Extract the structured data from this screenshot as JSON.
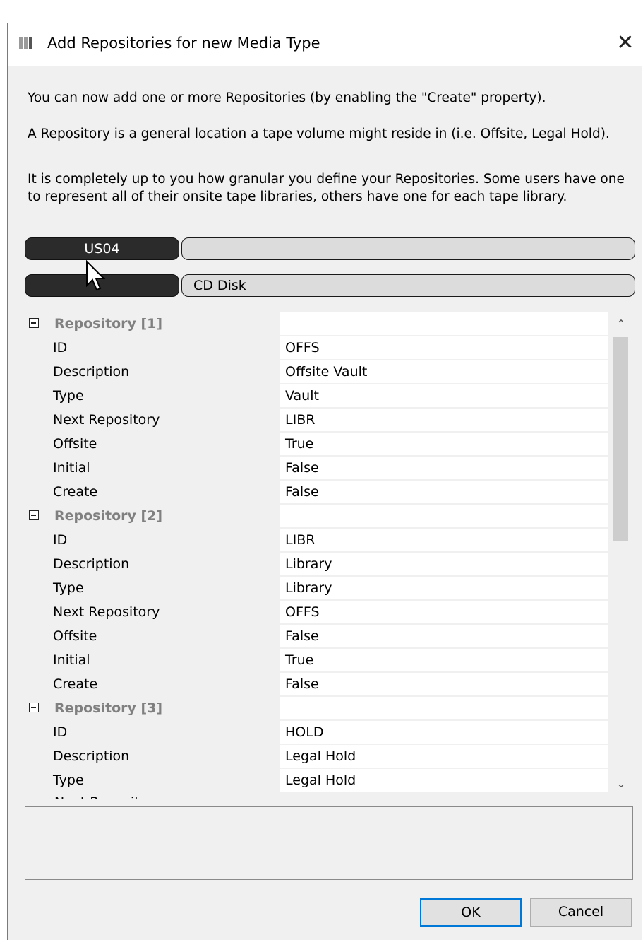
{
  "dialog": {
    "title": "Add Repositories for new Media Type",
    "close_glyph": "✕",
    "app_icon": "app-window-icon"
  },
  "intro": {
    "line1": "You can now add one or more Repositories (by enabling the \"Create\" property).",
    "line2": "A Repository is a general location a tape volume might reside in (i.e. Offsite, Legal Hold).",
    "line3": "It is completely up to you how granular you define your Repositories. Some users have one to represent all of their onsite tape libraries, others have one for each tape library."
  },
  "selectors": {
    "site_label": "US04",
    "site_value": "",
    "media_label": "",
    "media_value": "CD Disk"
  },
  "grid": {
    "repositories": [
      {
        "header": "Repository [1]",
        "props": [
          {
            "key": "ID",
            "value": "OFFS"
          },
          {
            "key": "Description",
            "value": "Offsite Vault"
          },
          {
            "key": "Type",
            "value": "Vault"
          },
          {
            "key": "Next Repository",
            "value": "LIBR"
          },
          {
            "key": "Offsite",
            "value": "True"
          },
          {
            "key": "Initial",
            "value": "False"
          },
          {
            "key": "Create",
            "value": "False"
          }
        ]
      },
      {
        "header": "Repository [2]",
        "props": [
          {
            "key": "ID",
            "value": "LIBR"
          },
          {
            "key": "Description",
            "value": "Library"
          },
          {
            "key": "Type",
            "value": "Library"
          },
          {
            "key": "Next Repository",
            "value": "OFFS"
          },
          {
            "key": "Offsite",
            "value": "False"
          },
          {
            "key": "Initial",
            "value": "True"
          },
          {
            "key": "Create",
            "value": "False"
          }
        ]
      },
      {
        "header": "Repository [3]",
        "props": [
          {
            "key": "ID",
            "value": "HOLD"
          },
          {
            "key": "Description",
            "value": "Legal Hold"
          },
          {
            "key": "Type",
            "value": "Legal Hold"
          }
        ]
      }
    ],
    "partial_next_key": "Next Repository",
    "scroll_up_glyph": "⌃",
    "scroll_down_glyph": "⌄"
  },
  "buttons": {
    "ok": "OK",
    "cancel": "Cancel"
  },
  "colors": {
    "accent": "#0078d7",
    "dark_pill": "#2b2b2b",
    "category_text": "#808080"
  }
}
